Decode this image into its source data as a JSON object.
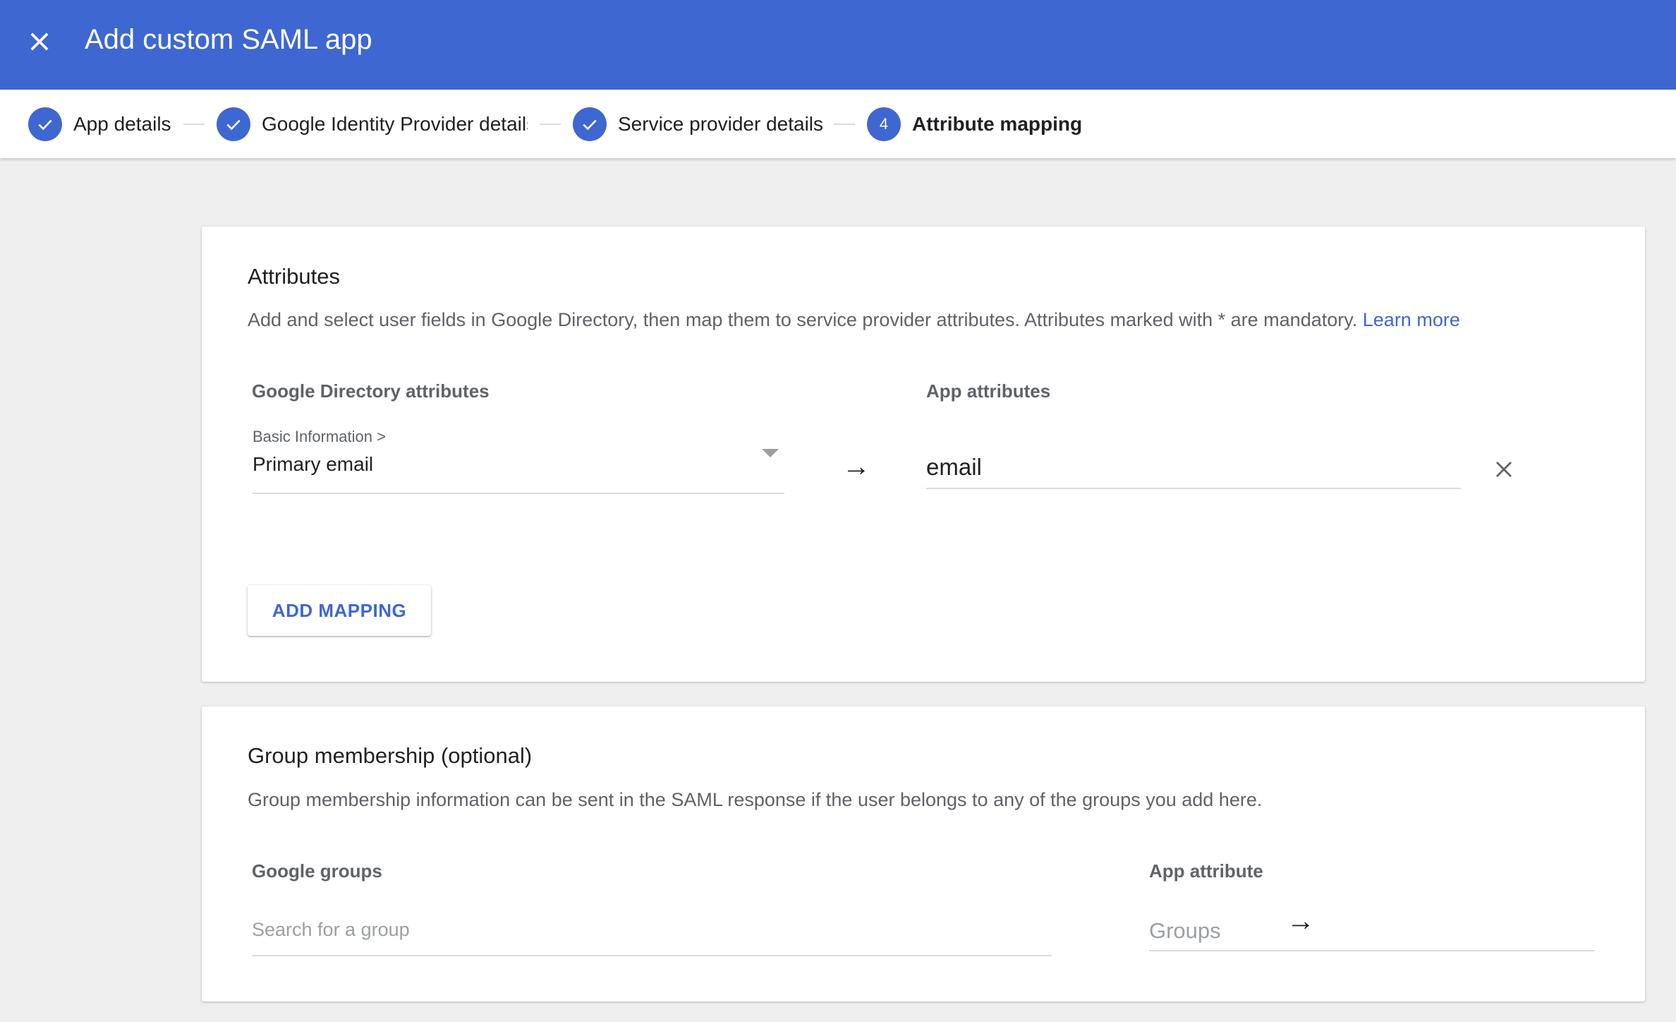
{
  "header": {
    "title": "Add custom SAML app",
    "close_icon": "close-icon"
  },
  "stepper": {
    "steps": [
      {
        "label": "App details",
        "state": "complete",
        "icon": "check-icon"
      },
      {
        "label": "Google Identity Provider details",
        "state": "complete",
        "icon": "check-icon"
      },
      {
        "label": "Service provider details",
        "state": "complete",
        "icon": "check-icon"
      },
      {
        "label": "Attribute mapping",
        "state": "active",
        "number": "4"
      }
    ]
  },
  "attributes": {
    "title": "Attributes",
    "description": "Add and select user fields in Google Directory, then map them to service provider attributes. Attributes marked with * are mandatory.",
    "learn_more": "Learn more",
    "directory_header": "Google Directory attributes",
    "app_header": "App attributes",
    "mapping": {
      "category": "Basic Information >",
      "field": "Primary email",
      "arrow": "→",
      "app_value": "email"
    },
    "add_mapping_label": "ADD MAPPING"
  },
  "group_membership": {
    "title": "Group membership (optional)",
    "description": "Group membership information can be sent in the SAML response if the user belongs to any of the groups you add here.",
    "groups_header": "Google groups",
    "app_attribute_header": "App attribute",
    "search_placeholder": "Search for a group",
    "arrow": "→",
    "app_attribute_placeholder": "Groups"
  },
  "colors": {
    "primary": "#3f67d1",
    "background": "#efefef"
  }
}
